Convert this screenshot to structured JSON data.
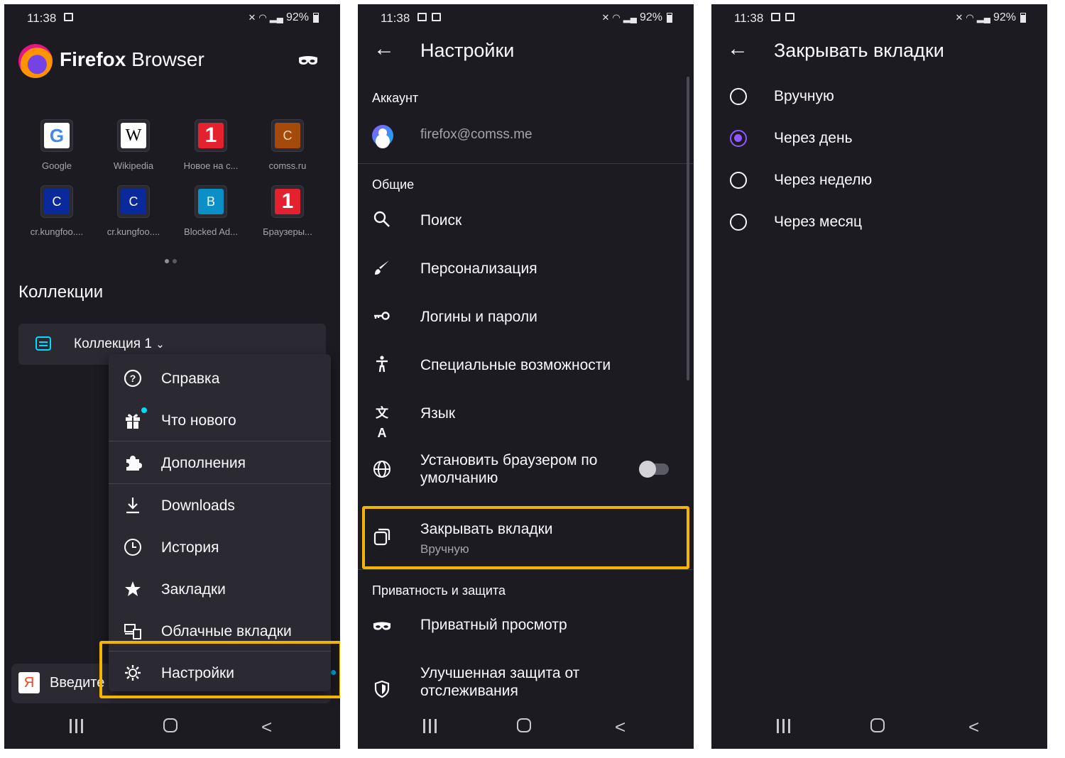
{
  "status": {
    "time": "11:38",
    "battery": "92%"
  },
  "home": {
    "brand_bold": "Firefox",
    "brand_rest": " Browser",
    "top_sites": [
      {
        "label": "Google",
        "glyph": "G"
      },
      {
        "label": "Wikipedia",
        "glyph": "W"
      },
      {
        "label": "Новое на с...",
        "glyph": "1"
      },
      {
        "label": "comss.ru",
        "glyph": "C"
      },
      {
        "label": "cr.kungfoo....",
        "glyph": "C"
      },
      {
        "label": "cr.kungfoo....",
        "glyph": "C"
      },
      {
        "label": "Blocked Ad...",
        "glyph": "B"
      },
      {
        "label": "Браузеры...",
        "glyph": "1"
      }
    ],
    "collections_heading": "Коллекции",
    "collection_title": "Коллекция 1",
    "search_text": "Введите",
    "yandex_glyph": "Я"
  },
  "menu": {
    "items": [
      {
        "label": "Справка",
        "icon": "help-icon"
      },
      {
        "label": "Что нового",
        "icon": "gift-icon"
      },
      {
        "label": "Дополнения",
        "icon": "addons-icon"
      },
      {
        "label": "Downloads",
        "icon": "download-icon"
      },
      {
        "label": "История",
        "icon": "history-icon"
      },
      {
        "label": "Закладки",
        "icon": "bookmark-icon"
      },
      {
        "label": "Облачные вкладки",
        "icon": "synced-tabs-icon"
      },
      {
        "label": "Настройки",
        "icon": "settings-icon"
      }
    ]
  },
  "settings": {
    "title": "Настройки",
    "account_section": "Аккаунт",
    "account_email": "firefox@comss.me",
    "general_section": "Общие",
    "items": [
      {
        "label": "Поиск"
      },
      {
        "label": "Персонализация"
      },
      {
        "label": "Логины и пароли"
      },
      {
        "label": "Специальные возможности"
      },
      {
        "label": "Язык"
      },
      {
        "label": "Установить браузером по умолчанию"
      }
    ],
    "close_tabs_label": "Закрывать вкладки",
    "close_tabs_value": "Вручную",
    "privacy_section": "Приватность и защита",
    "private_browsing": "Приватный просмотр",
    "tracking_protection": "Улучшенная защита от отслеживания"
  },
  "close_tabs": {
    "title": "Закрывать вкладки",
    "options": [
      "Вручную",
      "Через день",
      "Через неделю",
      "Через месяц"
    ],
    "selected_index": 1
  },
  "colors": {
    "highlight": "#f5b400",
    "accent": "#9059ff",
    "background": "#1c1b22",
    "surface": "#2b2a33"
  }
}
